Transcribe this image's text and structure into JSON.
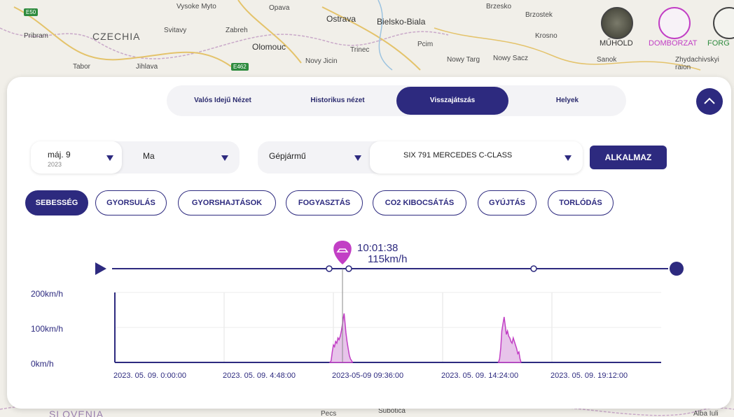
{
  "map": {
    "cities": [
      "Vysoke Myto",
      "Opava",
      "Ostrava",
      "Bielsko-Biala",
      "Brzesko",
      "Brzostek",
      "Pribram",
      "CZECHIA",
      "Svitavy",
      "Zabreh",
      "Olomouc",
      "Trinec",
      "Pcim",
      "Krosno",
      "Tabor",
      "Jihlava",
      "Novy Jicin",
      "Nowy Targ",
      "Nowy Sacz",
      "Sanok",
      "Zhydachivskyi raion",
      "SLOVENIA",
      "Pecs",
      "Subotica",
      "Alba Iuli"
    ],
    "road_badges": [
      "E50",
      "E462"
    ],
    "layers": {
      "satellite_label": "MŰHOLD",
      "terrain_label": "DOMBORZAT",
      "roads_label": "FORG"
    }
  },
  "tabs": [
    {
      "label": "Valós Idejű Nézet"
    },
    {
      "label": "Historikus nézet"
    },
    {
      "label": "Visszajátszás"
    },
    {
      "label": "Helyek"
    }
  ],
  "active_tab": "Visszajátszás",
  "filters": {
    "date_from": {
      "value": "máj. 9",
      "year": "2023"
    },
    "date_to": {
      "value": "Ma"
    },
    "vehicle_type": {
      "value": "Gépjármű"
    },
    "vehicle": {
      "value": "SIX 791  MERCEDES C-CLASS"
    },
    "apply_label": "ALKALMAZ"
  },
  "metrics": [
    {
      "label": "SEBESSÉG",
      "active": true
    },
    {
      "label": "GYORSULÁS",
      "active": false
    },
    {
      "label": "GYORSHAJTÁSOK",
      "active": false
    },
    {
      "label": "FOGYASZTÁS",
      "active": false
    },
    {
      "label": "CO2 KIBOCSÁTÁS",
      "active": false
    },
    {
      "label": "GYÚJTÁS",
      "active": false
    },
    {
      "label": "TORLÓDÁS",
      "active": false
    }
  ],
  "playback": {
    "marker_time": "10:01:38",
    "marker_speed": "115km/h"
  },
  "colors": {
    "primary": "#2d2a7f",
    "accent": "#c23fc5",
    "fill": "#e7c4ea"
  },
  "chart_data": {
    "type": "area",
    "ylabels": [
      "200km/h",
      "100km/h",
      "0km/h"
    ],
    "xlabels": [
      "2023. 05. 09. 0:00:00",
      "2023. 05. 09. 4:48:00",
      "2023-05-09 09:36:00",
      "2023. 05. 09. 14:24:00",
      "2023. 05. 09. 19:12:00"
    ],
    "ylim": [
      0,
      200
    ],
    "x_hours_range": [
      0,
      24
    ],
    "series": [
      {
        "x_hours": [
          9.45,
          9.5,
          9.55,
          9.6,
          9.65,
          9.7,
          9.75,
          9.8,
          9.85,
          9.9,
          9.95,
          10.0,
          10.03,
          10.07,
          10.1,
          10.15,
          10.2,
          10.25,
          10.3,
          10.35,
          10.4,
          10.45
        ],
        "values": [
          0,
          5,
          30,
          50,
          45,
          60,
          55,
          70,
          65,
          75,
          90,
          110,
          125,
          140,
          120,
          85,
          60,
          40,
          20,
          10,
          5,
          0
        ]
      },
      {
        "x_hours": [
          16.85,
          16.9,
          16.95,
          17.0,
          17.05,
          17.1,
          17.15,
          17.2,
          17.25,
          17.3,
          17.35,
          17.4,
          17.45,
          17.5,
          17.55,
          17.6,
          17.65,
          17.7,
          17.75,
          17.8,
          17.85
        ],
        "values": [
          0,
          10,
          40,
          90,
          110,
          130,
          105,
          80,
          90,
          75,
          70,
          60,
          55,
          70,
          60,
          50,
          40,
          25,
          30,
          10,
          0
        ]
      }
    ]
  }
}
